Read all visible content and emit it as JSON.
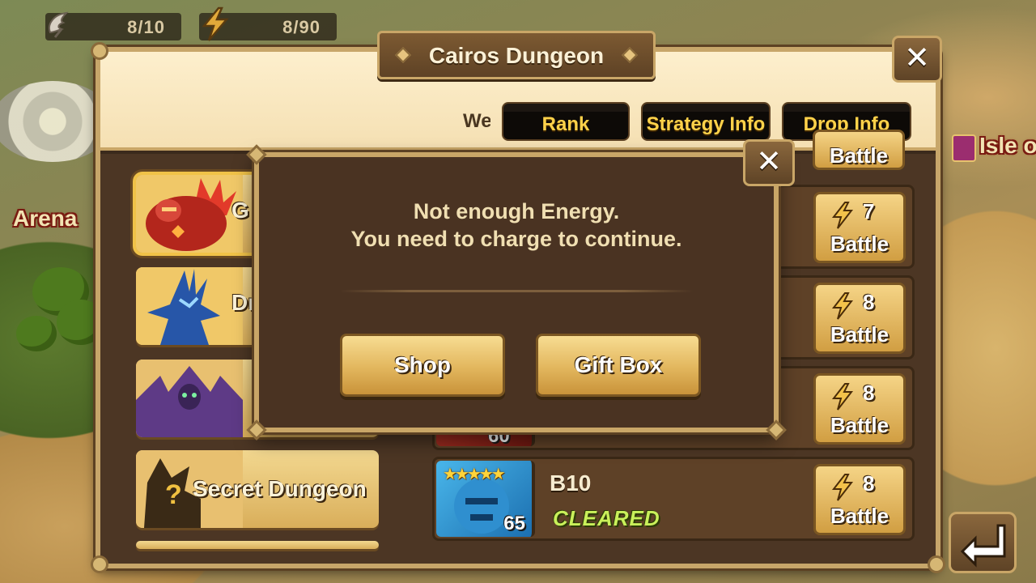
{
  "resources": [
    {
      "name": "wings",
      "icon": "wing-icon",
      "value": "8/10"
    },
    {
      "name": "energy",
      "icon": "energy-icon",
      "value": "8/90"
    }
  ],
  "map": {
    "labels": [
      "Arena",
      "Isle o"
    ]
  },
  "dungeon": {
    "title": "Cairos Dungeon",
    "welcome_fragment": "We",
    "tabs": [
      "Rank",
      "Strategy Info",
      "Drop Info"
    ]
  },
  "dungeon_list": [
    {
      "label": "G",
      "icon": "giant-portrait",
      "selected": true
    },
    {
      "label": "Dr",
      "icon": "dragon-portrait",
      "selected": false
    },
    {
      "label": "",
      "icon": "necropolis-portrait",
      "selected": false
    },
    {
      "label": "Secret Dungeon",
      "icon": "mystery-portrait",
      "selected": false
    }
  ],
  "stages": [
    {
      "name": "",
      "status": "",
      "level": "",
      "cost": "7",
      "button": "Battle"
    },
    {
      "name": "",
      "status": "",
      "level": "",
      "cost": "8",
      "button": "Battle"
    },
    {
      "name": "",
      "status": "",
      "level": "60",
      "cost": "8",
      "button": "Battle"
    },
    {
      "name": "B10",
      "status": "CLEARED",
      "level": "65",
      "stars": 5,
      "cost": "8",
      "button": "Battle"
    }
  ],
  "stage_top_partial_button": "Battle",
  "popup": {
    "line1": "Not enough Energy.",
    "line2": "You need to charge to continue.",
    "shop_label": "Shop",
    "giftbox_label": "Gift Box"
  },
  "close_symbol": "✕",
  "stars_text": "★★★★★",
  "colors": {
    "accent_gold": "#c9a667",
    "tab_text": "#ffd24a",
    "cleared_green": "#c9f05a",
    "panel_brown": "#4a3322"
  }
}
